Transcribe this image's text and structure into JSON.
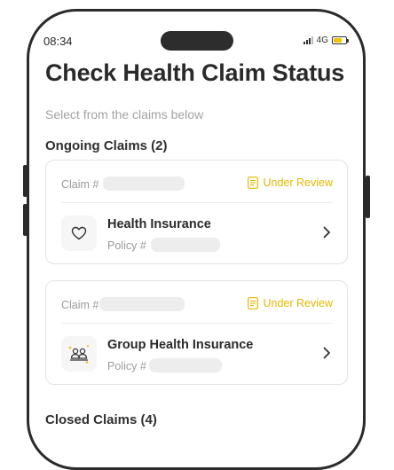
{
  "status_bar": {
    "time": "08:34",
    "network": "4G",
    "battery_color": "#f2c400",
    "battery_level": 0.7
  },
  "header": {
    "title": "Check Health Claim Status",
    "subtitle": "Select from the claims below"
  },
  "ongoing": {
    "section_title": "Ongoing Claims (2)",
    "claims": [
      {
        "claim_label": "Claim #",
        "status": "Under Review",
        "plan_name": "Health Insurance",
        "policy_label": "Policy #",
        "icon": "heart-icon"
      },
      {
        "claim_label": "Claim #",
        "status": "Under Review",
        "plan_name": "Group Health Insurance",
        "policy_label": "Policy #",
        "icon": "group-people-icon"
      }
    ]
  },
  "closed": {
    "section_title": "Closed Claims (4)"
  },
  "colors": {
    "status_accent": "#e4b800",
    "title_text": "#2a2a2a",
    "muted_text": "#9b9b9b"
  }
}
